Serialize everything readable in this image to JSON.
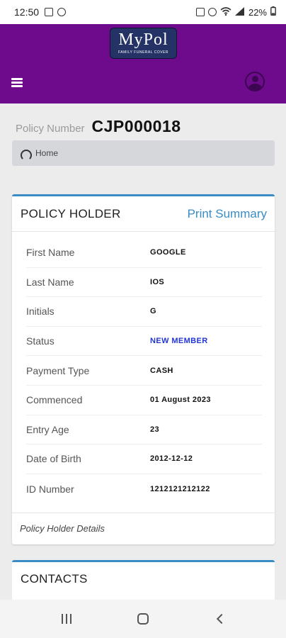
{
  "status_bar": {
    "time": "12:50",
    "battery": "22%",
    "left_icons": [
      "image-icon",
      "whatsapp-icon"
    ],
    "right_icons": [
      "battery-saver-icon",
      "alarm-icon",
      "wifi-icon",
      "signal-icon",
      "battery-icon"
    ]
  },
  "header": {
    "logo_text": "MyPol",
    "logo_subtext": "FAMILY FUNERAL COVER",
    "colors": {
      "bar": "#6d0b8c",
      "logo_bg": "#243266",
      "accent": "#3a8cc4"
    }
  },
  "policy": {
    "label": "Policy Number",
    "number": "CJP000018"
  },
  "breadcrumb": {
    "home": "Home"
  },
  "policy_holder": {
    "title": "POLICY HOLDER",
    "print_link": "Print Summary",
    "fields": [
      {
        "label": "First Name",
        "value": "GOOGLE"
      },
      {
        "label": "Last Name",
        "value": "IOS"
      },
      {
        "label": "Initials",
        "value": "G"
      },
      {
        "label": "Status",
        "value": "NEW MEMBER"
      },
      {
        "label": "Payment Type",
        "value": "CASH"
      },
      {
        "label": "Commenced",
        "value": "01 August 2023"
      },
      {
        "label": "Entry Age",
        "value": "23"
      },
      {
        "label": "Date of Birth",
        "value": "2012-12-12"
      },
      {
        "label": "ID Number",
        "value": "1212121212122"
      }
    ],
    "footer": "Policy Holder Details"
  },
  "contacts": {
    "title": "CONTACTS"
  }
}
